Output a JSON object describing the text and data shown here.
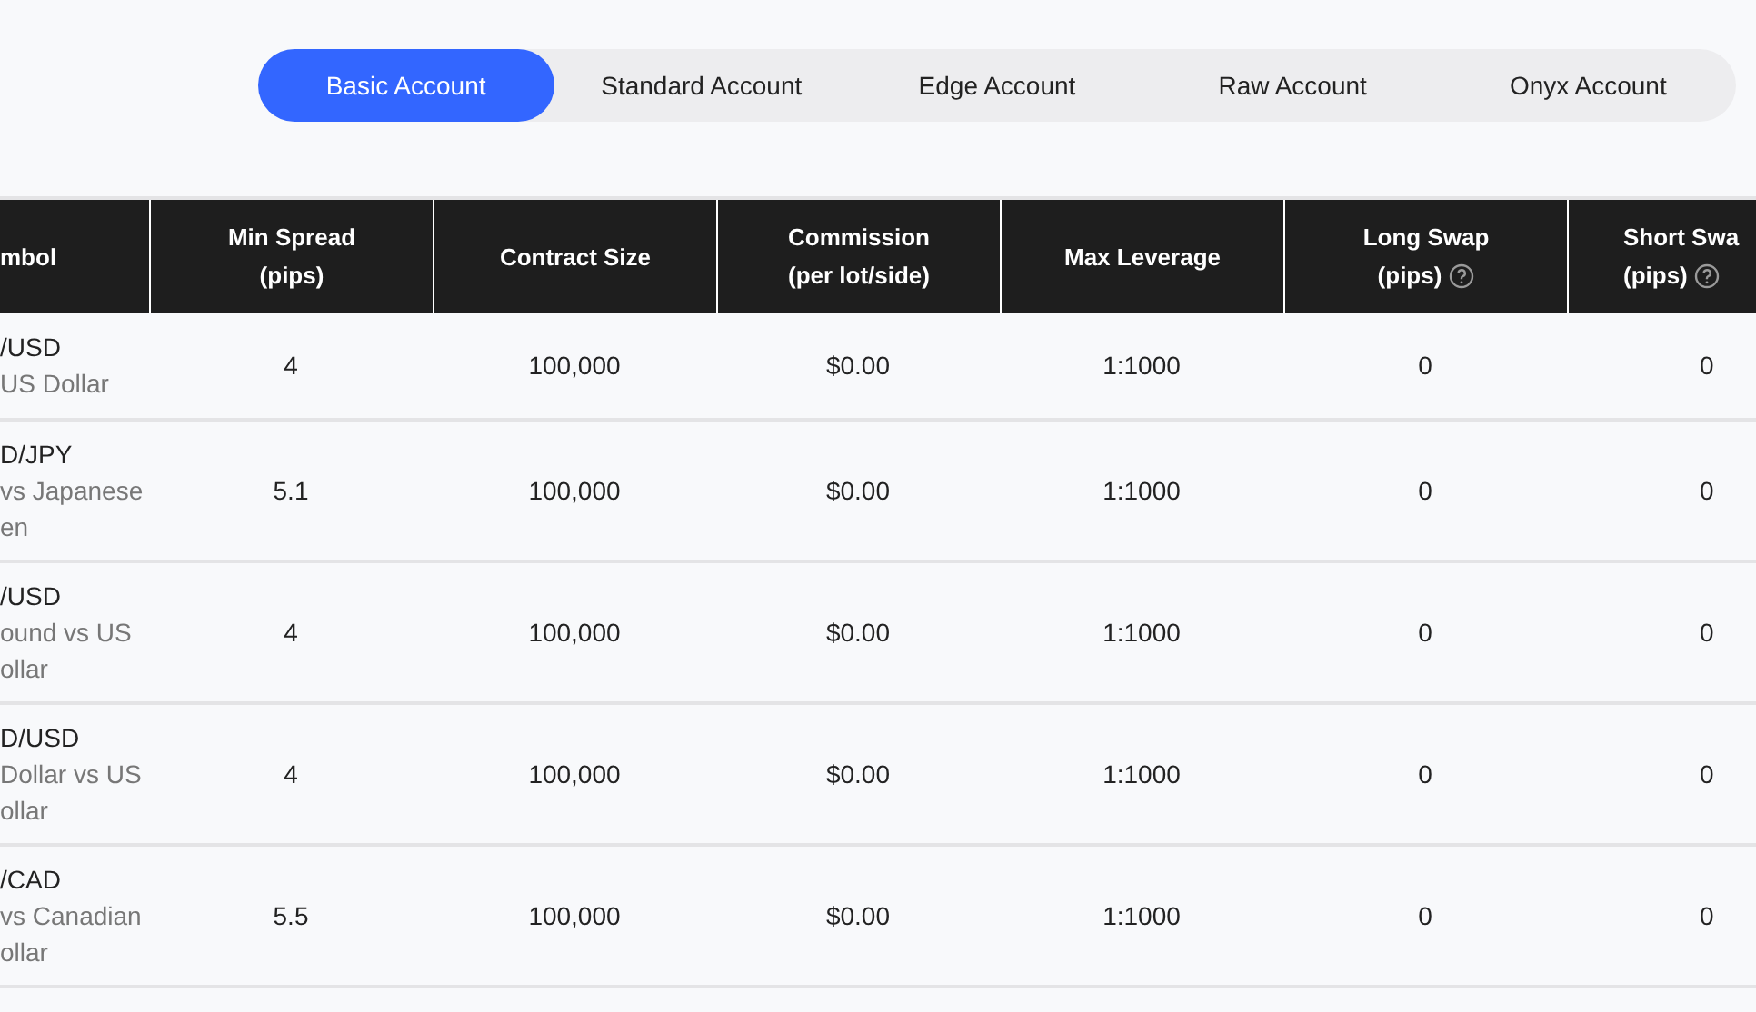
{
  "tabs": [
    {
      "label": "Basic Account",
      "selected": true
    },
    {
      "label": "Standard Account",
      "selected": false
    },
    {
      "label": "Edge Account",
      "selected": false
    },
    {
      "label": "Raw Account",
      "selected": false
    },
    {
      "label": "Onyx Account",
      "selected": false
    }
  ],
  "table": {
    "columns": [
      {
        "lines": [
          "mbol"
        ],
        "help": false
      },
      {
        "lines": [
          "Min Spread",
          "(pips)"
        ],
        "help": false
      },
      {
        "lines": [
          "Contract Size"
        ],
        "help": false
      },
      {
        "lines": [
          "Commission",
          "(per lot/side)"
        ],
        "help": false
      },
      {
        "lines": [
          "Max Leverage"
        ],
        "help": false
      },
      {
        "lines": [
          "Long Swap",
          "(pips)"
        ],
        "help": true
      },
      {
        "lines": [
          "Short Swa",
          "(pips)"
        ],
        "help": true
      }
    ],
    "rows": [
      {
        "cells": [
          {
            "kind": "symbol",
            "symbol": "/USD",
            "description": [
              "US Dollar"
            ]
          },
          {
            "kind": "text",
            "text": "4"
          },
          {
            "kind": "text",
            "text": "100,000"
          },
          {
            "kind": "text",
            "text": "$0.00"
          },
          {
            "kind": "text",
            "text": "1:1000"
          },
          {
            "kind": "text",
            "text": "0"
          },
          {
            "kind": "text",
            "text": "0"
          }
        ]
      },
      {
        "cells": [
          {
            "kind": "symbol",
            "symbol": "D/JPY",
            "description": [
              "vs Japanese",
              "en"
            ]
          },
          {
            "kind": "text",
            "text": "5.1"
          },
          {
            "kind": "text",
            "text": "100,000"
          },
          {
            "kind": "text",
            "text": "$0.00"
          },
          {
            "kind": "text",
            "text": "1:1000"
          },
          {
            "kind": "text",
            "text": "0"
          },
          {
            "kind": "text",
            "text": "0"
          }
        ]
      },
      {
        "cells": [
          {
            "kind": "symbol",
            "symbol": "/USD",
            "description": [
              "ound vs US",
              "ollar"
            ]
          },
          {
            "kind": "text",
            "text": "4"
          },
          {
            "kind": "text",
            "text": "100,000"
          },
          {
            "kind": "text",
            "text": "$0.00"
          },
          {
            "kind": "text",
            "text": "1:1000"
          },
          {
            "kind": "text",
            "text": "0"
          },
          {
            "kind": "text",
            "text": "0"
          }
        ]
      },
      {
        "cells": [
          {
            "kind": "symbol",
            "symbol": "D/USD",
            "description": [
              "Dollar vs US",
              "ollar"
            ]
          },
          {
            "kind": "text",
            "text": "4"
          },
          {
            "kind": "text",
            "text": "100,000"
          },
          {
            "kind": "text",
            "text": "$0.00"
          },
          {
            "kind": "text",
            "text": "1:1000"
          },
          {
            "kind": "text",
            "text": "0"
          },
          {
            "kind": "text",
            "text": "0"
          }
        ]
      },
      {
        "cells": [
          {
            "kind": "symbol",
            "symbol": "/CAD",
            "description": [
              "vs Canadian",
              "ollar"
            ]
          },
          {
            "kind": "text",
            "text": "5.5"
          },
          {
            "kind": "text",
            "text": "100,000"
          },
          {
            "kind": "text",
            "text": "$0.00"
          },
          {
            "kind": "text",
            "text": "1:1000"
          },
          {
            "kind": "text",
            "text": "0"
          },
          {
            "kind": "text",
            "text": "0"
          }
        ]
      }
    ]
  }
}
